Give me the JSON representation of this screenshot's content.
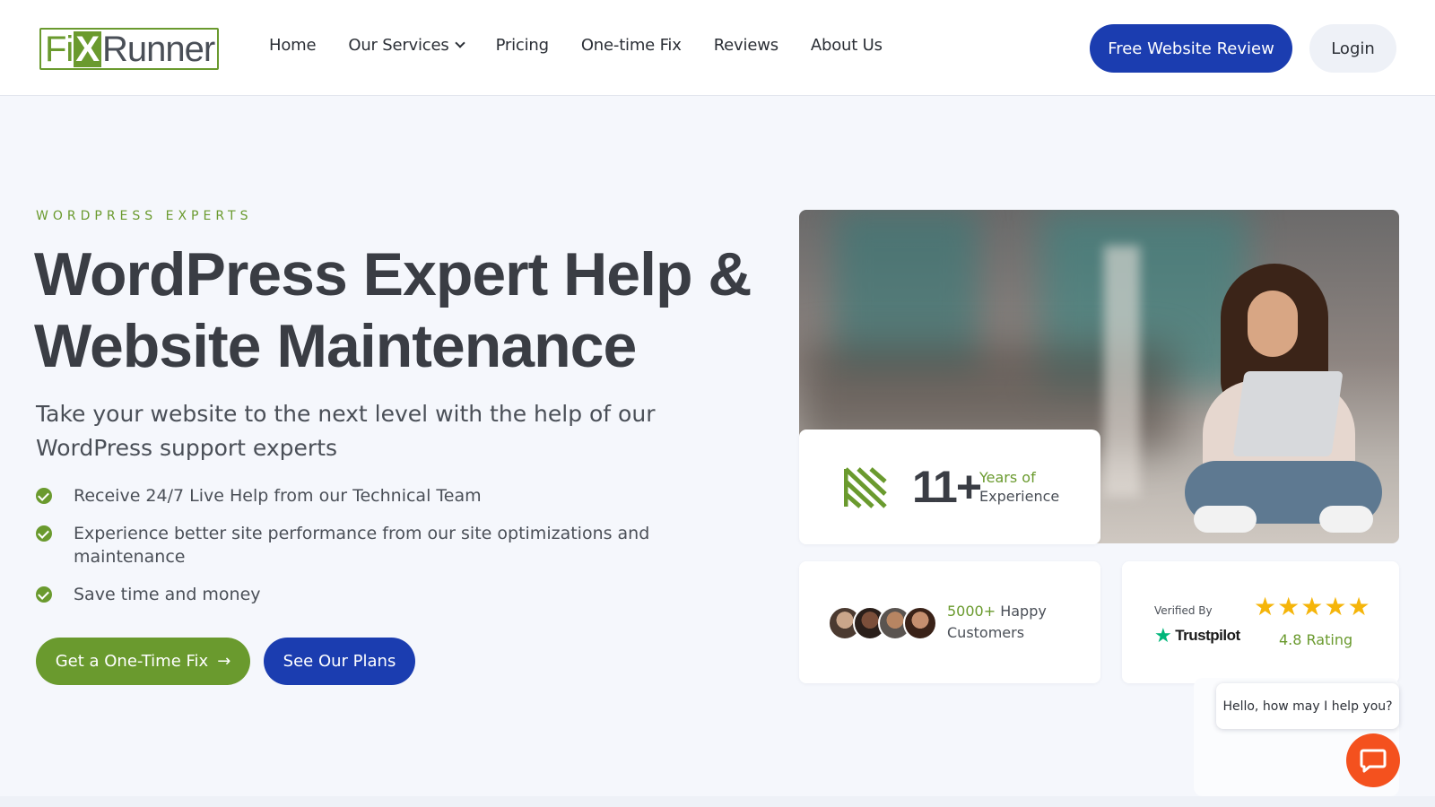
{
  "header": {
    "logo": {
      "fix": "Fi",
      "x": "X",
      "runner": "Runner"
    },
    "nav": [
      {
        "label": "Home"
      },
      {
        "label": "Our Services",
        "has_dropdown": true
      },
      {
        "label": "Pricing"
      },
      {
        "label": "One-time Fix"
      },
      {
        "label": "Reviews"
      },
      {
        "label": "About Us"
      }
    ],
    "review_button": "Free Website Review",
    "login_button": "Login"
  },
  "hero": {
    "eyebrow": "WORDPRESS EXPERTS",
    "title": "WordPress Expert Help & Website Maintenance",
    "subtitle": "Take your website to the next level with the help of our WordPress support experts",
    "features": [
      "Receive 24/7 Live Help from our Technical Team",
      "Experience better site performance from our site optimizations and maintenance",
      "Save time and money"
    ],
    "primary_cta": "Get a One-Time Fix",
    "secondary_cta": "See Our Plans"
  },
  "stats": {
    "experience": {
      "number": "11+",
      "line1": "Years of",
      "line2": "Experience"
    },
    "customers": {
      "count": "5000+",
      "line1": "Happy",
      "line2": "Customers"
    },
    "trustpilot": {
      "verified": "Verified By",
      "brand": "Trustpilot",
      "stars": 5,
      "rating": "4.8 Rating"
    }
  },
  "chat": {
    "bubble": "Hello, how may I help you?"
  },
  "colors": {
    "brand_green": "#6a9a2e",
    "brand_blue": "#1b3db0",
    "chat_orange": "#f4511e",
    "star_gold": "#f5b50a",
    "trustpilot_green": "#00b67a"
  },
  "icons": [
    "chevron-down-icon",
    "check-circle-icon",
    "arrow-right-icon",
    "stripes-icon",
    "star-icon",
    "trustpilot-star-icon",
    "chat-icon"
  ]
}
